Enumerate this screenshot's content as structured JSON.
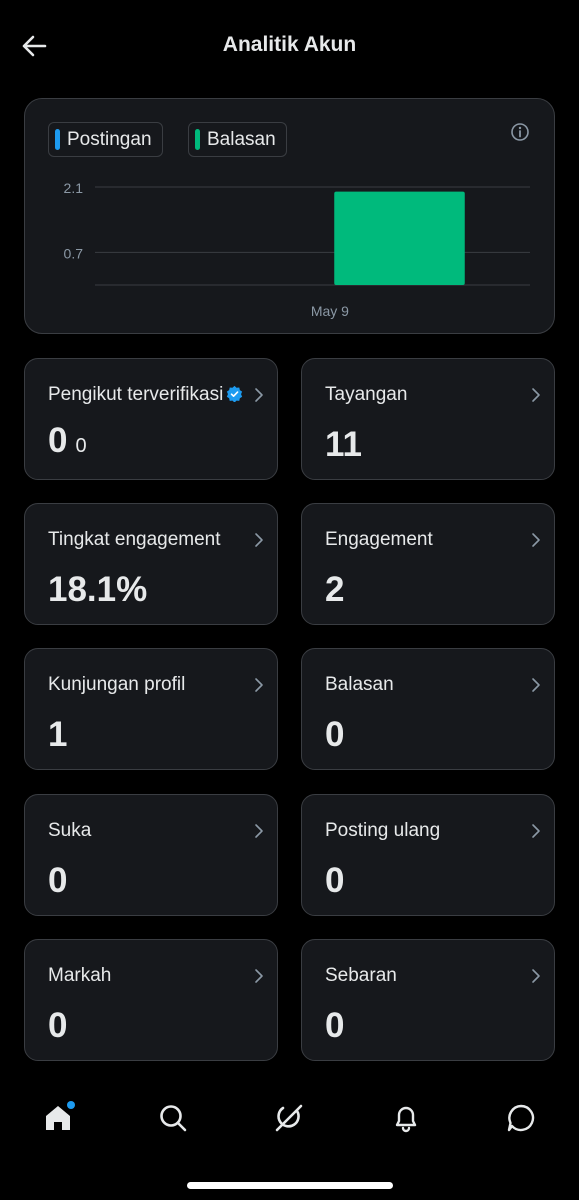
{
  "header": {
    "title": "Analitik Akun"
  },
  "chart_data": {
    "type": "bar",
    "series": [
      {
        "name": "Postingan",
        "color": "#1d9bf0",
        "values": [
          0
        ]
      },
      {
        "name": "Balasan",
        "color": "#00ba7c",
        "values": [
          2
        ]
      }
    ],
    "categories": [
      "May 9"
    ],
    "yticks": [
      "2.1",
      "0.7"
    ],
    "ylim": [
      0,
      2.1
    ]
  },
  "metrics": [
    {
      "label": "Pengikut terverifikasi",
      "value": "0",
      "sub": "0",
      "verified_icon": "verified-badge-icon",
      "verified_color": "#1d9bf0"
    },
    {
      "label": "Tayangan",
      "value": "11"
    },
    {
      "label": "Tingkat engagement",
      "value": "18.1%"
    },
    {
      "label": "Engagement",
      "value": "2"
    },
    {
      "label": "Kunjungan profil",
      "value": "1"
    },
    {
      "label": "Balasan",
      "value": "0"
    },
    {
      "label": "Suka",
      "value": "0"
    },
    {
      "label": "Posting ulang",
      "value": "0"
    },
    {
      "label": "Markah",
      "value": "0"
    },
    {
      "label": "Sebaran",
      "value": "0"
    }
  ],
  "nav": {
    "items": [
      "home-icon",
      "search-icon",
      "grok-icon",
      "notifications-icon",
      "messages-icon"
    ],
    "home_has_notification": true
  }
}
